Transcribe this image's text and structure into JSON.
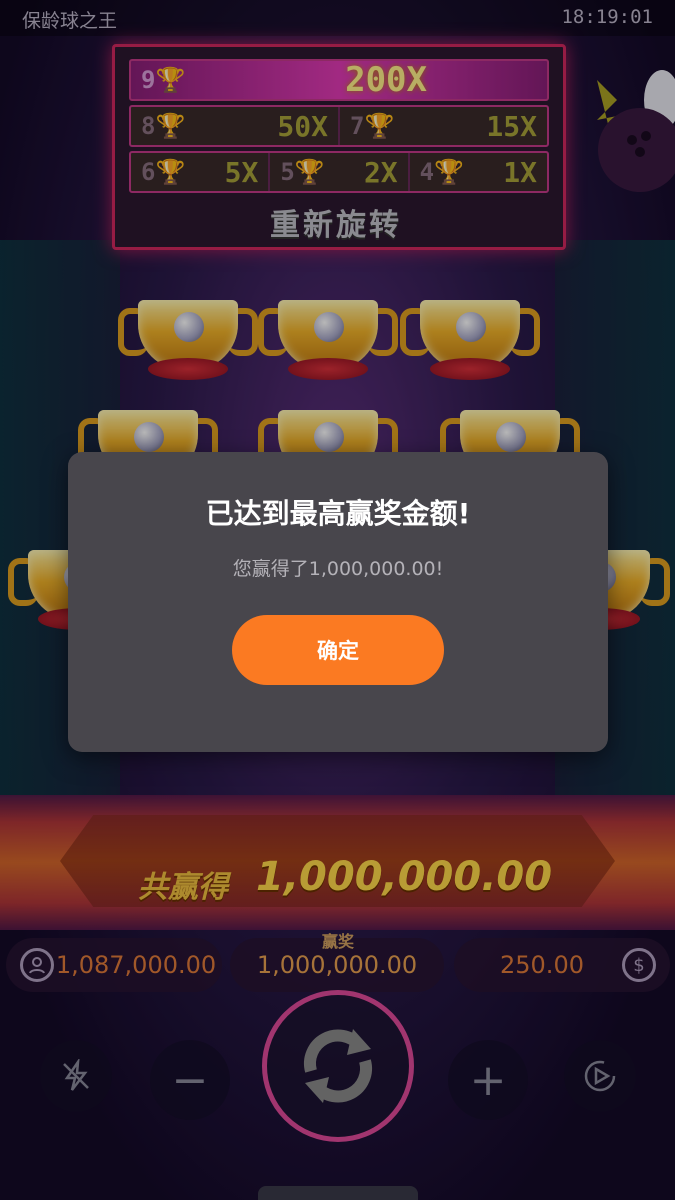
{
  "status_bar": {
    "app_title": "保龄球之王",
    "time": "18:19:01"
  },
  "paytable": {
    "top": {
      "rank": "9",
      "multiplier": "200X"
    },
    "row2": [
      {
        "rank": "8",
        "multiplier": "50X"
      },
      {
        "rank": "7",
        "multiplier": "15X"
      }
    ],
    "row3": [
      {
        "rank": "6",
        "multiplier": "5X"
      },
      {
        "rank": "5",
        "multiplier": "2X"
      },
      {
        "rank": "4",
        "multiplier": "1X"
      }
    ],
    "respin_label": "重新旋转"
  },
  "modal": {
    "title": "已达到最高赢奖金额!",
    "message": "您赢得了1,000,000.00!",
    "confirm_label": "确定"
  },
  "total_win": {
    "label": "共赢得",
    "amount": "1,000,000.00"
  },
  "info": {
    "balance": "1,087,000.00",
    "win_label": "赢奖",
    "win": "1,000,000.00",
    "bet": "250.00"
  },
  "icons": {
    "balance": "user-icon",
    "bet": "coin-icon",
    "turbo": "turbo-off-icon",
    "spin": "spin-arrows-icon",
    "autoplay": "autoplay-icon",
    "trophy": "trophy-icon"
  },
  "colors": {
    "accent": "#fb7a22",
    "modal_bg": "#48464c",
    "gold": "#ffd84a",
    "neon_pink": "#e04a9a"
  }
}
